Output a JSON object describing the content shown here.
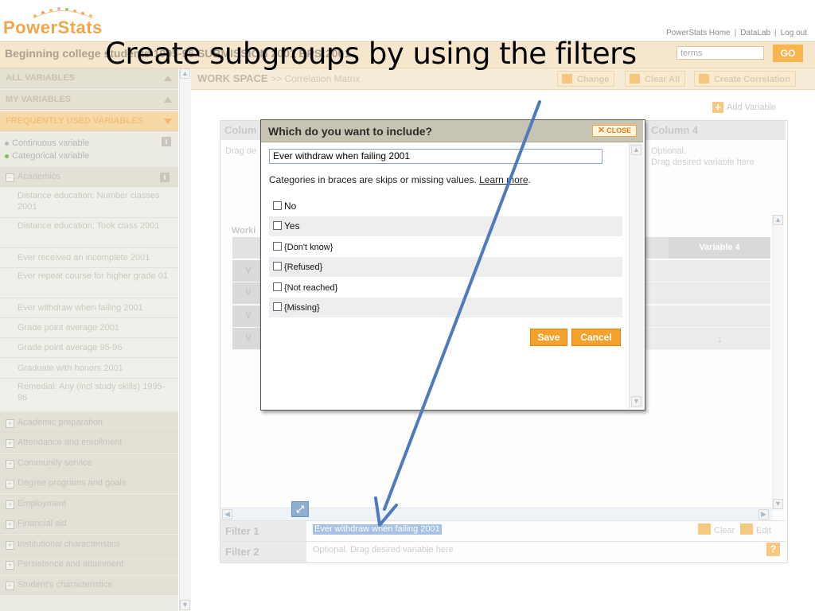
{
  "slide_title": "Create subgroups by using the filters",
  "app": {
    "logo_text": "PowerStats",
    "top_links": [
      "PowerStats Home",
      "DataLab",
      "Log out"
    ],
    "study_title": "Beginning college students 1995-96 SUBMISSION 2001 BPS:2001",
    "search_placeholder": "terms",
    "go_label": "GO"
  },
  "sidebar": {
    "sections": [
      "ALL VARIABLES",
      "MY VARIABLES",
      "FREQUENTLY USED VARIABLES"
    ],
    "legend": [
      "Continuous variable",
      "Categorical variable"
    ],
    "legend_colors": [
      "#b7b7b7",
      "#7dbf6b"
    ],
    "open_category": "Academics",
    "variables": [
      "Distance education: Number classes 2001",
      "Distance education: Took class 2001",
      "Ever received an incomplete 2001",
      "Ever repeat course for higher grade 01",
      "Ever withdraw when failing 2001",
      "Grade point average 2001",
      "Grade point average 95-96",
      "Graduate with honors 2001",
      "Remedial: Any (incl study skills) 1995-96"
    ],
    "categories": [
      "Academic preparation",
      "Attendance and enrollment",
      "Community service",
      "Degree programs and goals",
      "Employment",
      "Financial aid",
      "Institutional characteristics",
      "Persistence and attainment",
      "Student's characteristics"
    ]
  },
  "workspace": {
    "title": "WORK SPACE",
    "subtitle": ">> Correlation Matrix",
    "buttons": [
      "Change",
      "Clear All",
      "Create Correlation"
    ],
    "add_variable": "Add Variable",
    "column_labels": [
      "Colum",
      "Column 4"
    ],
    "drag_left": "Drag de",
    "optional_text": "Optional.",
    "drag_desired": "Drag desired variable here",
    "working_label": "Worki",
    "variable4_header": "Variable 4",
    "row_labels": [
      "V",
      "V",
      "V",
      "V"
    ],
    "cell_value": "1",
    "filters": [
      {
        "label": "Filter 1",
        "value": "Ever withdraw when failing 2001"
      },
      {
        "label": "Filter 2",
        "value": "Optional. Drag desired variable here"
      }
    ],
    "clear_label": "Clear",
    "edit_label": "Edit",
    "help_label": "?"
  },
  "modal": {
    "title": "Which do you want to include?",
    "close_label": "CLOSE",
    "variable_name": "Ever withdraw when failing 2001",
    "note_prefix": "Categories in braces are skips or missing values.",
    "learn_more": "Learn more",
    "note_suffix": ".",
    "options": [
      "No",
      "Yes",
      "{Don't know}",
      "{Refused}",
      "{Not reached}",
      "{Missing}"
    ],
    "save_label": "Save",
    "cancel_label": "Cancel"
  },
  "colors": {
    "accent": "#f4a22b",
    "arrow": "#4e7ac0",
    "highlight": "#a5c1e5"
  }
}
